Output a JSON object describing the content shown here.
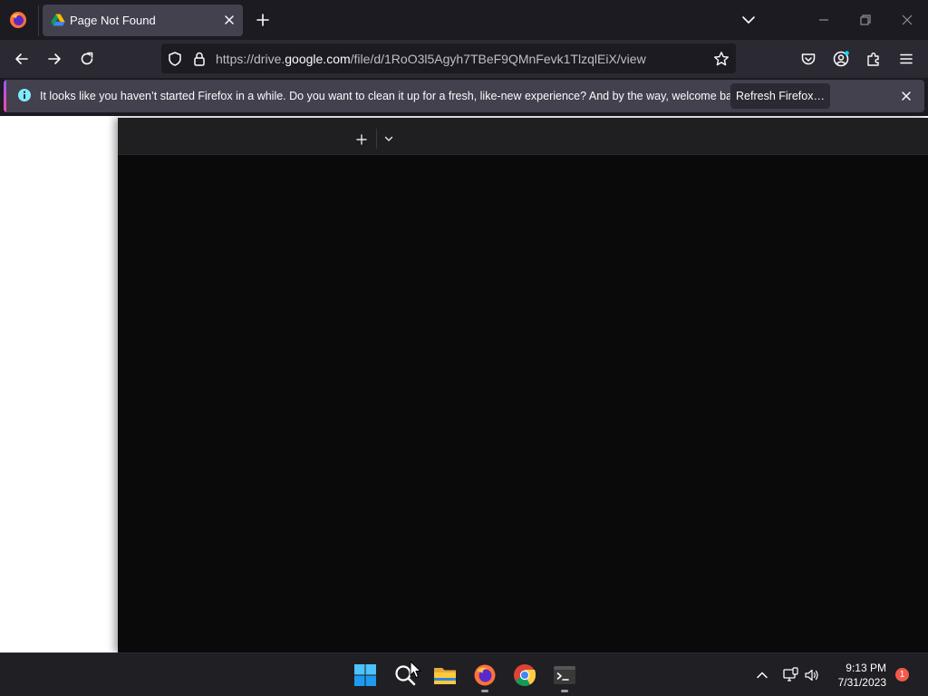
{
  "browser": {
    "tab": {
      "title": "Page Not Found"
    },
    "url": {
      "scheme": "https://drive.",
      "host": "google.com",
      "path": "/file/d/1RoO3l5Agyh7TBeF9QMnFevk1TlzqlEiX/view"
    }
  },
  "notification": {
    "message": "It looks like you haven’t started Firefox in a while. Do you want to clean it up for a fresh, like-new experience? And by the way, welcome back!",
    "button_label": "Refresh Firefox…"
  },
  "taskbar": {
    "apps": [
      "windows-start",
      "search",
      "file-explorer",
      "firefox",
      "chrome",
      "terminal"
    ],
    "clock": {
      "time": "9:13 PM",
      "date": "7/31/2023"
    },
    "notification_count": "1"
  },
  "colors": {
    "toolbar_bg": "#2b2a33",
    "tab_active": "#42414d",
    "viewer_bg": "#0a0a0b",
    "accent_gradient": [
      "#9059ff",
      "#ff4aa2"
    ],
    "badge": "#f25a4a"
  }
}
